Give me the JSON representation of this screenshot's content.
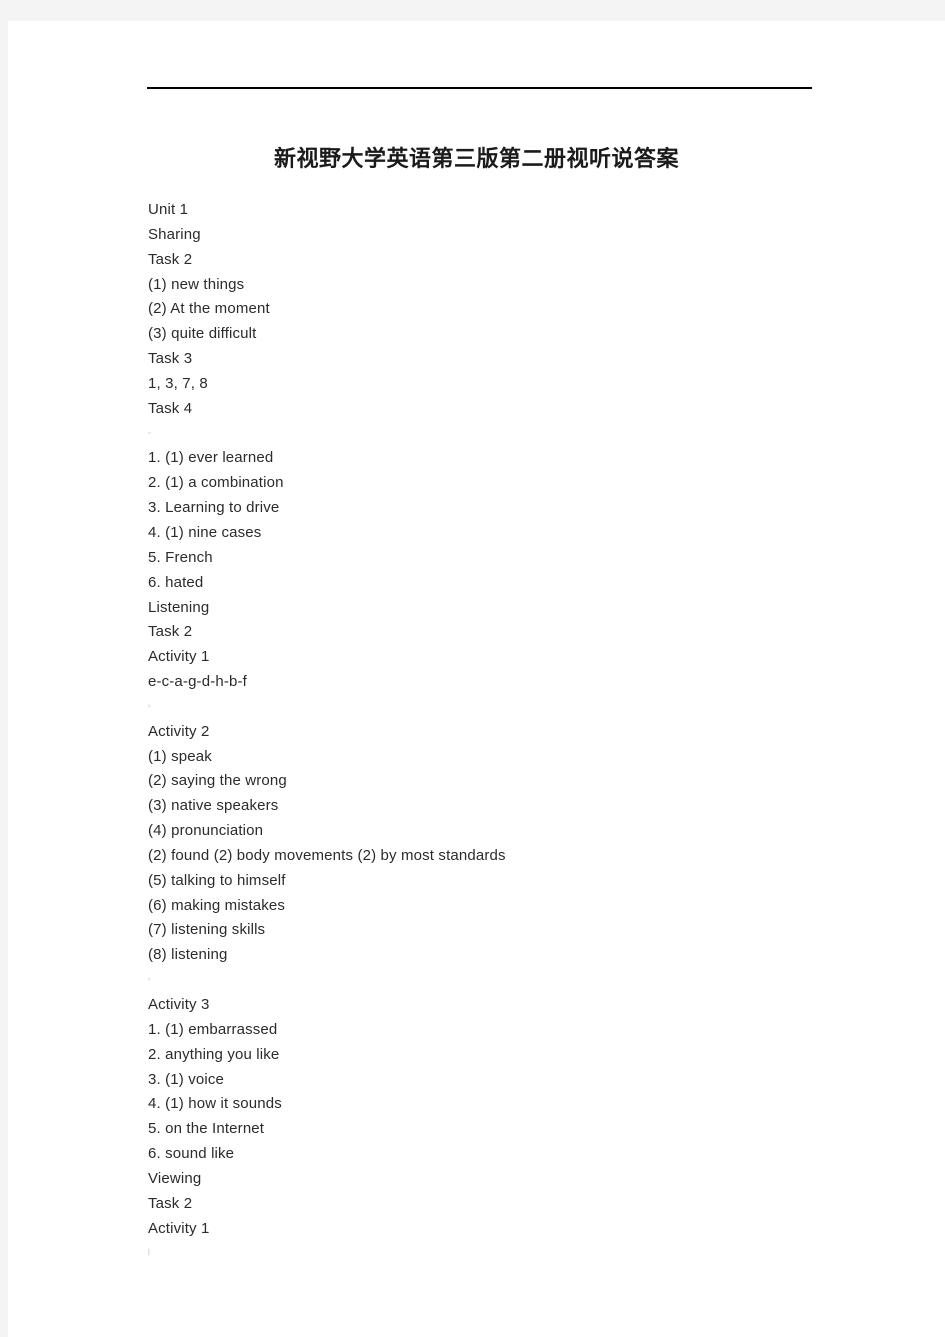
{
  "document": {
    "title": "新视野大学英语第三版第二册视听说答案",
    "header_rule": true,
    "lines": [
      {
        "id": "unit-1",
        "text": "Unit 1",
        "kind": "heading"
      },
      {
        "id": "sharing",
        "text": "Sharing",
        "kind": "heading"
      },
      {
        "id": "sharing-task-2",
        "text": "Task 2",
        "kind": "heading"
      },
      {
        "id": "s-t2-1",
        "text": "(1) new things",
        "kind": "answer"
      },
      {
        "id": "s-t2-2",
        "text": "(2) At the moment",
        "kind": "answer"
      },
      {
        "id": "s-t2-3",
        "text": "(3) quite difficult",
        "kind": "answer"
      },
      {
        "id": "sharing-task-3",
        "text": "Task 3",
        "kind": "heading"
      },
      {
        "id": "s-t3-ans",
        "text": "1, 3, 7, 8",
        "kind": "answer"
      },
      {
        "id": "sharing-task-4",
        "text": "Task 4",
        "kind": "heading"
      },
      {
        "id": "artifact-1",
        "text": "▫",
        "kind": "artifact"
      },
      {
        "id": "s-t4-1",
        "text": "1. (1) ever learned",
        "kind": "answer"
      },
      {
        "id": "s-t4-2",
        "text": "2. (1) a combination",
        "kind": "answer"
      },
      {
        "id": "s-t4-3",
        "text": "3. Learning to drive",
        "kind": "answer"
      },
      {
        "id": "s-t4-4",
        "text": "4. (1) nine cases",
        "kind": "answer"
      },
      {
        "id": "s-t4-5",
        "text": "5. French",
        "kind": "answer"
      },
      {
        "id": "s-t4-6",
        "text": "6. hated",
        "kind": "answer"
      },
      {
        "id": "listening",
        "text": "Listening",
        "kind": "heading"
      },
      {
        "id": "listening-task-2",
        "text": "Task 2",
        "kind": "heading"
      },
      {
        "id": "l-activity-1",
        "text": "Activity 1",
        "kind": "heading"
      },
      {
        "id": "l-a1-ans",
        "text": "e-c-a-g-d-h-b-f",
        "kind": "answer"
      },
      {
        "id": "artifact-2",
        "text": "›",
        "kind": "artifact"
      },
      {
        "id": "l-activity-2",
        "text": "Activity 2",
        "kind": "heading"
      },
      {
        "id": "l-a2-1",
        "text": "(1) speak",
        "kind": "answer"
      },
      {
        "id": "l-a2-2",
        "text": "(2) saying the wrong",
        "kind": "answer"
      },
      {
        "id": "l-a2-3",
        "text": "(3) native speakers",
        "kind": "answer"
      },
      {
        "id": "l-a2-4",
        "text": "(4) pronunciation",
        "kind": "answer"
      },
      {
        "id": "l-a2-extra",
        "text": "(2) found (2) body movements (2) by most standards",
        "kind": "answer"
      },
      {
        "id": "l-a2-5",
        "text": "(5) talking to himself",
        "kind": "answer"
      },
      {
        "id": "l-a2-6",
        "text": "(6) making mistakes",
        "kind": "answer"
      },
      {
        "id": "l-a2-7",
        "text": "(7) listening skills",
        "kind": "answer"
      },
      {
        "id": "l-a2-8",
        "text": "(8) listening",
        "kind": "answer"
      },
      {
        "id": "artifact-3",
        "text": "‹",
        "kind": "artifact"
      },
      {
        "id": "l-activity-3",
        "text": "Activity 3",
        "kind": "heading"
      },
      {
        "id": "l-a3-1",
        "text": "1. (1) embarrassed",
        "kind": "answer"
      },
      {
        "id": "l-a3-2",
        "text": "2. anything you like",
        "kind": "answer"
      },
      {
        "id": "l-a3-3",
        "text": "3. (1) voice",
        "kind": "answer"
      },
      {
        "id": "l-a3-4",
        "text": "4. (1) how it sounds",
        "kind": "answer"
      },
      {
        "id": "l-a3-5",
        "text": "5. on the Internet",
        "kind": "answer"
      },
      {
        "id": "l-a3-6",
        "text": "6. sound like",
        "kind": "answer"
      },
      {
        "id": "viewing",
        "text": "Viewing",
        "kind": "heading"
      },
      {
        "id": "viewing-task-2",
        "text": "Task 2",
        "kind": "heading"
      },
      {
        "id": "v-activity-1",
        "text": "Activity 1",
        "kind": "heading"
      },
      {
        "id": "artifact-4",
        "text": "|",
        "kind": "artifact"
      }
    ]
  },
  "colors": {
    "page_background": "#ffffff",
    "canvas_background": "#f4f4f4",
    "body_text": "#2b2b2b",
    "title_text": "#1b1b1b",
    "rule": "#000000",
    "artifact": "#b9b9b9"
  }
}
